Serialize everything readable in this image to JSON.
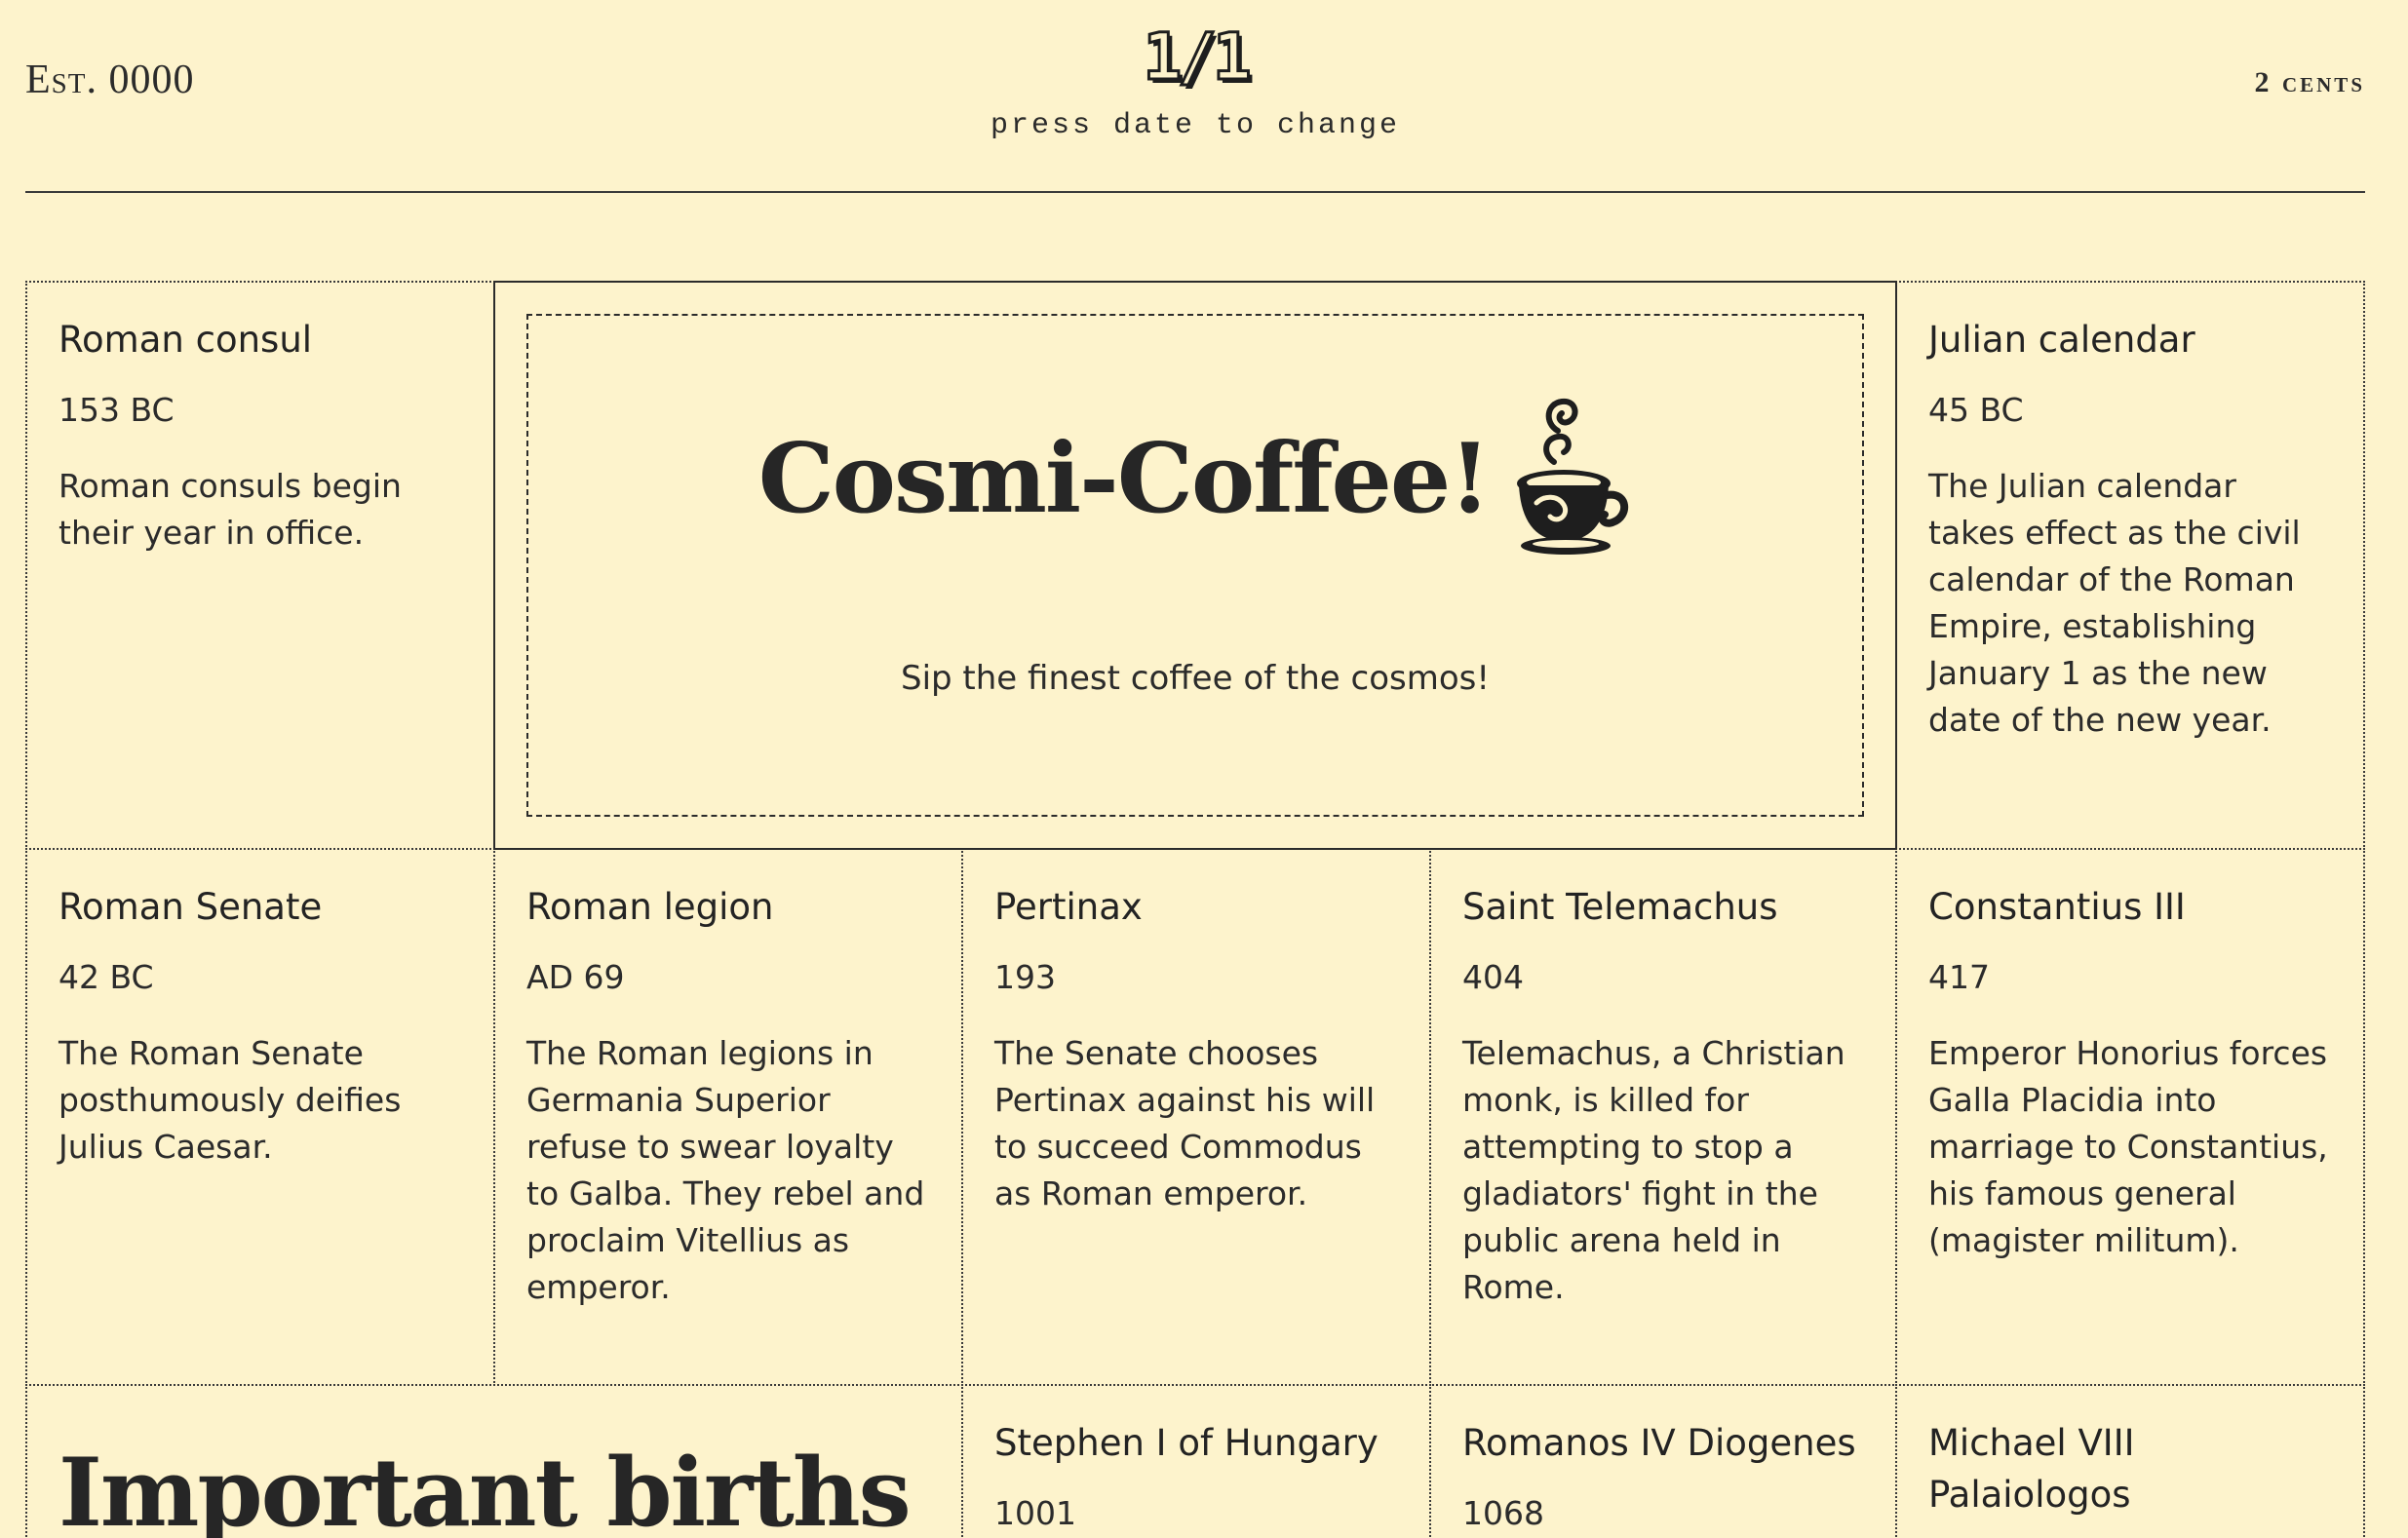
{
  "masthead": {
    "established": "Est. 0000",
    "date": "1/1",
    "date_hint": "press date to change",
    "price": "2 cents"
  },
  "ad": {
    "title": "Cosmi-Coffee!",
    "tagline": "Sip the finest coffee of the cosmos!",
    "icon": "coffee-cup-icon"
  },
  "events": [
    {
      "title": "Roman consul",
      "year": "153 BC",
      "text": "Roman consuls begin their year in office."
    },
    {
      "title": "Julian calendar",
      "year": "45 BC",
      "text": "The Julian calendar takes effect as the civil calendar of the Roman Empire, establishing January 1 as the new date of the new year."
    },
    {
      "title": "Roman Senate",
      "year": "42 BC",
      "text": "The Roman Senate posthumously deifies Julius Caesar."
    },
    {
      "title": "Roman legion",
      "year": "AD 69",
      "text": "The Roman legions in Germania Superior refuse to swear loyalty to Galba. They rebel and proclaim Vitellius as emperor."
    },
    {
      "title": "Pertinax",
      "year": "193",
      "text": "The Senate chooses Pertinax against his will to succeed Commodus as Roman emperor."
    },
    {
      "title": "Saint Telemachus",
      "year": "404",
      "text": "Telemachus, a Christian monk, is killed for attempting to stop a gladiators' fight in the public arena held in Rome."
    },
    {
      "title": "Constantius III",
      "year": "417",
      "text": "Emperor Honorius forces Galla Placidia into marriage to Constantius, his famous general (magister militum)."
    }
  ],
  "births": {
    "section_title": "Important births",
    "items": [
      {
        "title": "Stephen I of Hungary",
        "year": "1001"
      },
      {
        "title": "Romanos IV Diogenes",
        "year": "1068"
      },
      {
        "title": "Michael VIII Palaiologos",
        "year": ""
      }
    ]
  }
}
